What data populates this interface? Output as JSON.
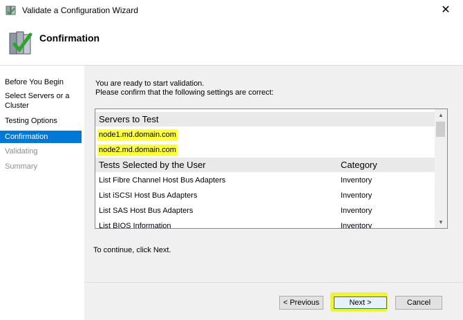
{
  "window": {
    "title": "Validate a Configuration Wizard",
    "close_glyph": "✕",
    "app_icon": "cluster-wizard-icon"
  },
  "header": {
    "title": "Confirmation",
    "icon": "server-checkmark-icon"
  },
  "nav": {
    "items": [
      {
        "label": "Before You Begin",
        "state": "normal"
      },
      {
        "label": "Select Servers or a Cluster",
        "state": "normal"
      },
      {
        "label": "Testing Options",
        "state": "normal"
      },
      {
        "label": "Confirmation",
        "state": "active"
      },
      {
        "label": "Validating",
        "state": "disabled"
      },
      {
        "label": "Summary",
        "state": "disabled"
      }
    ]
  },
  "intro": {
    "line1": "You are ready to start validation.",
    "line2": "Please confirm that the following settings are correct:"
  },
  "list": {
    "servers_header": "Servers to Test",
    "servers": [
      "node1.md.domain.com",
      "node2.md.domain.com"
    ],
    "tests_header": "Tests Selected by the User",
    "category_header": "Category",
    "tests": [
      {
        "name": "List Fibre Channel Host Bus Adapters",
        "category": "Inventory"
      },
      {
        "name": "List iSCSI Host Bus Adapters",
        "category": "Inventory"
      },
      {
        "name": "List SAS Host Bus Adapters",
        "category": "Inventory"
      },
      {
        "name": "List BIOS Information",
        "category": "Inventory"
      }
    ],
    "scroll_up_glyph": "▲",
    "scroll_down_glyph": "▼"
  },
  "continue_text": "To continue, click Next.",
  "buttons": {
    "previous": "< Previous",
    "next": "Next >",
    "cancel": "Cancel"
  },
  "colors": {
    "accent": "#0078d7",
    "highlight": "#ffff3a"
  }
}
